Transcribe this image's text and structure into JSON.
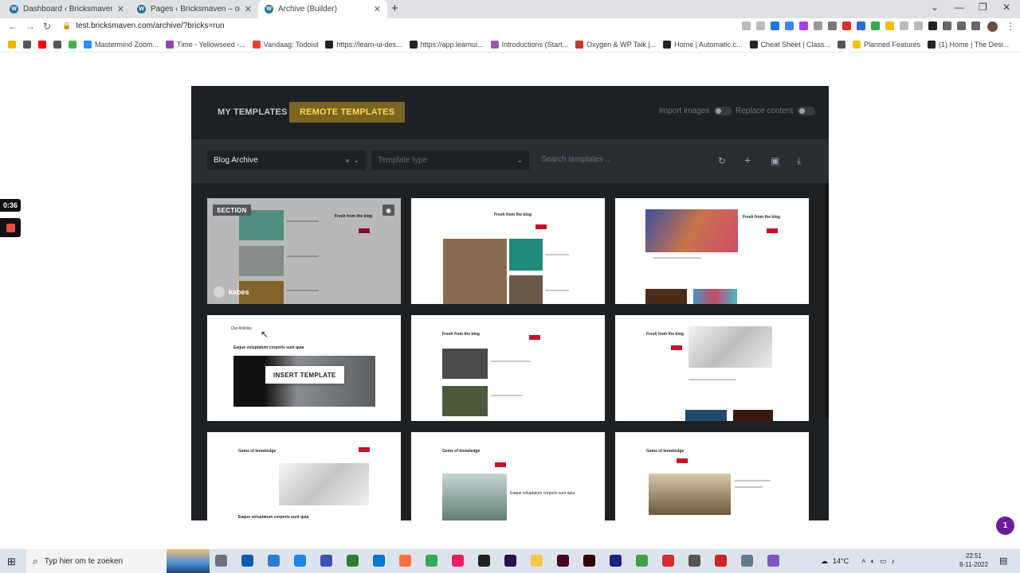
{
  "browser": {
    "tabs": [
      {
        "label": "Dashboard ‹ Bricksmaven – origin",
        "icon": "W"
      },
      {
        "label": "Pages ‹ Bricksmaven – origin — W",
        "icon": "W"
      },
      {
        "label": "Archive (Builder)",
        "icon": "W"
      }
    ],
    "url": "test.bricksmaven.com/archive/?bricks=run",
    "bookmarks": [
      {
        "label": "",
        "color": "#f4b400"
      },
      {
        "label": "",
        "color": "#555555"
      },
      {
        "label": "",
        "color": "#ff0000"
      },
      {
        "label": "",
        "color": "#555555"
      },
      {
        "label": "",
        "color": "#4caf50"
      },
      {
        "label": "Mastermind Zoom...",
        "color": "#2d8cff"
      },
      {
        "label": "Time - Yellowseed -...",
        "color": "#8e44ad"
      },
      {
        "label": "Vandaag: Todoist",
        "color": "#e44332"
      },
      {
        "label": "https://learn-ui-des...",
        "color": "#222222"
      },
      {
        "label": "https://app.learnui...",
        "color": "#222222"
      },
      {
        "label": "Introductions (Start...",
        "color": "#9b59b6"
      },
      {
        "label": "Oxygen & WP Talk |...",
        "color": "#c0392b"
      },
      {
        "label": "Home | Automatic.c...",
        "color": "#222222"
      },
      {
        "label": "Cheat Sheet | Class...",
        "color": "#222222"
      },
      {
        "label": "",
        "color": "#555555"
      },
      {
        "label": "Planned Features",
        "color": "#f1c40f"
      },
      {
        "label": "(1) Home | The Desi...",
        "color": "#222222"
      }
    ]
  },
  "recorder": {
    "time": "0:36"
  },
  "modal": {
    "tabs": {
      "my": "MY TEMPLATES",
      "remote": "REMOTE TEMPLATES"
    },
    "options": {
      "import_images": "Import images",
      "replace_content": "Replace content"
    },
    "filter": {
      "template_value": "Blog Archive",
      "template_type_placeholder": "Template type",
      "search_placeholder": "Search templates ..",
      "clear_symbol": "×",
      "chevron": "⌄"
    },
    "cards": {
      "badge": "SECTION",
      "author": "kabes",
      "insert_label": "INSERT TEMPLATE",
      "titles": [
        "Fresh from the blog",
        "Fresh from the blog",
        "Fresh from the blog",
        "Eaque voluptatum corporis sunt quia",
        "Fresh from the blog",
        "Fresh from the blog",
        "Gems of knowledge",
        "Gems of knowledge",
        "Gems of knowledge"
      ],
      "card4_heading": "Our Articles",
      "card7_sub": "Eaque voluptatum corporis sunt quia",
      "card8_sub": "Eaque voluptatum corporis sunt quia"
    },
    "colors": {
      "accent": "#ffd64f",
      "accent_bg": "#7a6523",
      "brand_red": "#c5112b"
    }
  },
  "notification": {
    "count": "1"
  },
  "taskbar": {
    "search_placeholder": "Typ hier om te zoeken",
    "weather": "14°C",
    "time": "22:51",
    "date": "8-11-2022"
  }
}
